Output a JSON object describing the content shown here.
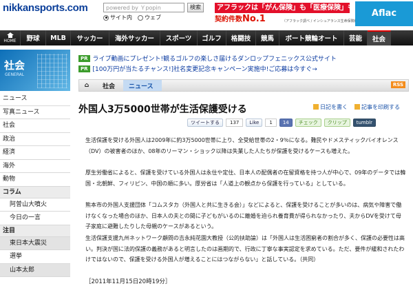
{
  "header": {
    "logo": "nikkansports.com",
    "search_placeholder": "powered by Ｙpopin",
    "search_button": "検索",
    "radio_site": "サイト内",
    "radio_web": "ウェブ"
  },
  "ads": {
    "line1": "アフラックは「がん保険」も「医療保険」も",
    "line2_prefix": "契約件数",
    "line2_big": "No.1",
    "note": "（アフラック調べ / インシュアランス生命保険統計号2011）",
    "brand": "Aflac"
  },
  "nav": {
    "home_label": "HOME",
    "items": [
      "野球",
      "MLB",
      "サッカー",
      "海外サッカー",
      "スポーツ",
      "ゴルフ",
      "格闘技",
      "競馬",
      "ボート競輪オート",
      "芸能",
      "社会"
    ],
    "active": "社会"
  },
  "promos": [
    {
      "badge": "PR",
      "text": "ライブ動画にプレゼント!観るゴルフの楽しさ届けるダンロップフェニックス公式サイト"
    },
    {
      "badge": "PR",
      "text": "[100万円が当たるチャンス!]社名変更記念キャンペーン実施中!ご応募は今すぐ→"
    }
  ],
  "sidebar": {
    "title": "社会",
    "subtitle": "GENERAL",
    "items": [
      {
        "label": "ニュース",
        "kind": "item"
      },
      {
        "label": "写真ニュース",
        "kind": "item"
      },
      {
        "label": "社会",
        "kind": "item"
      },
      {
        "label": "政治",
        "kind": "item"
      },
      {
        "label": "経済",
        "kind": "item"
      },
      {
        "label": "海外",
        "kind": "item"
      },
      {
        "label": "動物",
        "kind": "item"
      },
      {
        "label": "コラム",
        "kind": "sec"
      },
      {
        "label": "阿曽山大噴火",
        "kind": "sub"
      },
      {
        "label": "今日の一言",
        "kind": "sub"
      },
      {
        "label": "注目",
        "kind": "sec"
      },
      {
        "label": "東日本大震災",
        "kind": "sub"
      },
      {
        "label": "選挙",
        "kind": "sub"
      },
      {
        "label": "山本太郎",
        "kind": "sub"
      }
    ]
  },
  "breadcrumb": {
    "home": "⌂",
    "section": "社会",
    "current": "ニュース",
    "rss": "RSS"
  },
  "article": {
    "title": "外国人3万5000世帯が生活保護受ける",
    "tools": [
      "日記を書く",
      "記事を印刷する"
    ],
    "social": {
      "tweet": "ツイートする",
      "tweet_count": "137",
      "like": "Like",
      "like_count": "1",
      "fb_count": "14",
      "check": "チェック",
      "clip": "クリップ",
      "tumblr": "tumblr"
    },
    "paragraphs": [
      "生活保護を受ける外国人は2009年に約3万5000世帯に上り、全受給世帯の2・9％になる。難民やドメスティックバイオレンス（DV）の被害者のほか、08年のリーマン・ショック以降は失業した人たちが保護を受けるケースも増えた。",
      "厚生労働省によると、保護を受けている外国人は永住や定住、日本人の配偶者の在留資格を持つ人が中心で、09年のデータでは韓国・北朝鮮、フィリピン、中国の順に多い。厚労省は「人道上の観点から保護を行っている」としている。",
      "熊本市の外国人支援団体「コムスタカ（外国人と共に生きる会）」などによると、保護を受けることが多いのは、病気や障害で働けなくなった場合のほか、日本人の夫との間に子どもがいるのに離婚を迫られ養育費が得られなかったり、夫からDVを受けて母子家庭に避難したりした母親のケースがあるという。",
      "生活保護支援九州ネットワーク顧問の吉永純花園大教授（公的扶助論）は「外国人は生活困窮者の割合が多く、保護の必要性は高い。判決が国に法的保護の義務があると明言したのは画期的で、行政に丁寧な事実認定を求めている。ただ、要件が緩和されたわけではないので、保護を受ける外国人が増えることにはつながらない」と話している。（共同）"
    ],
    "dateline": "［2011年11月15日20時19分］"
  }
}
